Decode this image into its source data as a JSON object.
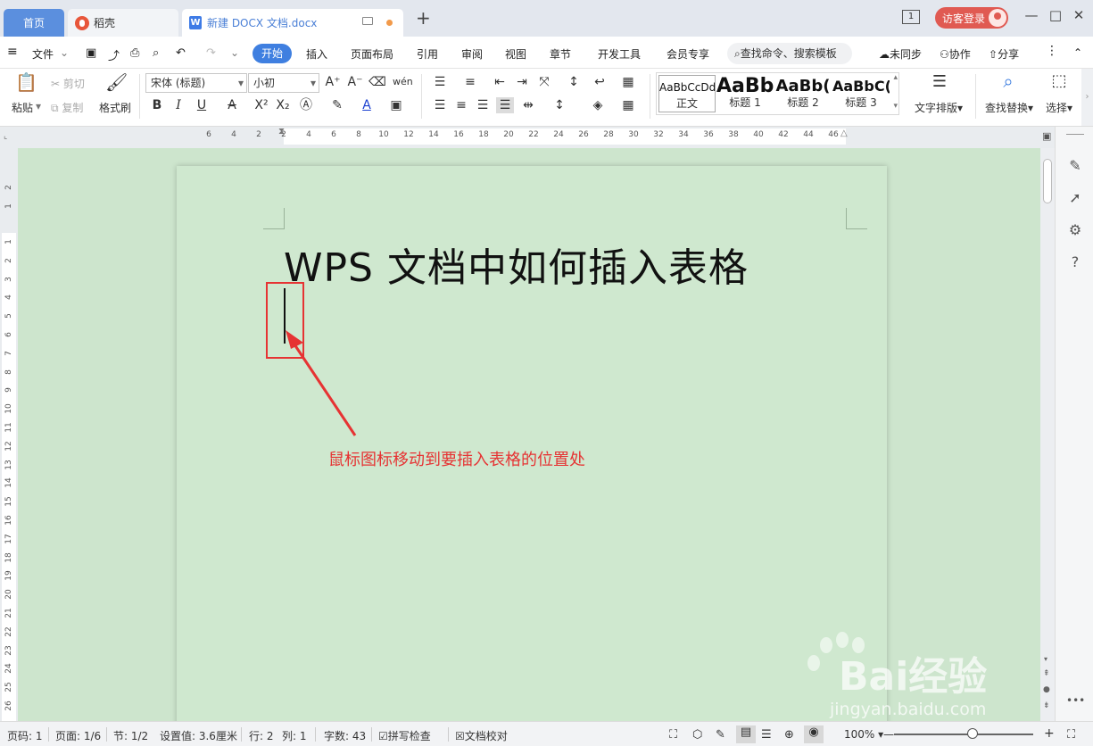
{
  "tabs": {
    "home": "首页",
    "daoke": "稻壳",
    "doc": "新建 DOCX 文档.docx",
    "page_badge": "1",
    "login": "访客登录"
  },
  "menu": {
    "items": [
      "文件",
      "开始",
      "插入",
      "页面布局",
      "引用",
      "审阅",
      "视图",
      "章节",
      "开发工具",
      "会员专享"
    ],
    "search_placeholder": "查找命令、搜索模板",
    "sync": "未同步",
    "collab": "协作",
    "share": "分享"
  },
  "ribbon": {
    "paste": "粘贴",
    "cut": "剪切",
    "copy": "复制",
    "format_painter": "格式刷",
    "font_name": "宋体 (标题)",
    "font_size": "小初",
    "styles": [
      {
        "sample": "AaBbCcDd",
        "name": "正文"
      },
      {
        "sample": "AaBb",
        "name": "标题 1"
      },
      {
        "sample": "AaBb(",
        "name": "标题 2"
      },
      {
        "sample": "AaBbC(",
        "name": "标题 3"
      }
    ],
    "text_layout": "文字排版",
    "find_replace": "查找替换",
    "select": "选择"
  },
  "ruler": {
    "h_ticks": [
      "6",
      "4",
      "2",
      "2",
      "4",
      "6",
      "8",
      "10",
      "12",
      "14",
      "16",
      "18",
      "20",
      "22",
      "24",
      "26",
      "28",
      "30",
      "32",
      "34",
      "36",
      "38",
      "40",
      "42",
      "44",
      "46"
    ],
    "v_ticks": [
      "2",
      "1",
      "1",
      "2",
      "3",
      "4",
      "5",
      "6",
      "7",
      "8",
      "9",
      "10",
      "11",
      "12",
      "13",
      "14",
      "15",
      "16",
      "17",
      "18",
      "19",
      "20",
      "21",
      "22",
      "23",
      "24",
      "25",
      "26"
    ]
  },
  "document": {
    "title": "WPS 文档中如何插入表格",
    "annotation": "鼠标图标移动到要插入表格的位置处"
  },
  "status": {
    "page_no": "页码: 1",
    "pages": "页面: 1/6",
    "section": "节: 1/2",
    "setting": "设置值: 3.6厘米",
    "row": "行: 2",
    "col": "列: 1",
    "words": "字数: 43",
    "spell_check": "拼写检查",
    "doc_proof": "文档校对",
    "zoom": "100%"
  },
  "watermark": {
    "brand": "Bai经验",
    "url": "jingyan.baidu.com"
  },
  "colors": {
    "accent": "#3f7fe0",
    "annotation_red": "#e63333",
    "page_green": "#cfe8cf"
  }
}
